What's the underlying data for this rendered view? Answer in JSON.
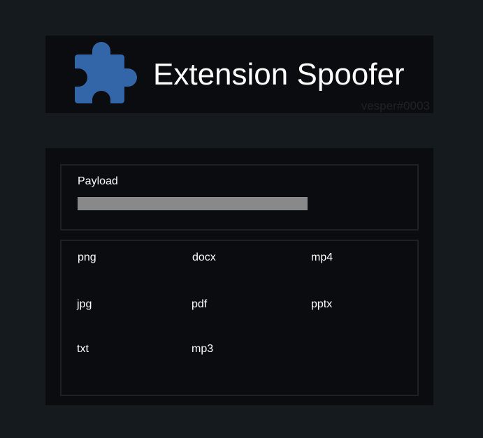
{
  "header": {
    "title": "Extension Spoofer",
    "watermark": "vesper#0003",
    "logo_icon": "puzzle-piece-icon",
    "logo_color": "#3366a8"
  },
  "payload": {
    "label": "Payload",
    "value": ""
  },
  "extensions": [
    "png",
    "docx",
    "mp4",
    "jpg",
    "pdf",
    "pptx",
    "txt",
    "mp3"
  ]
}
